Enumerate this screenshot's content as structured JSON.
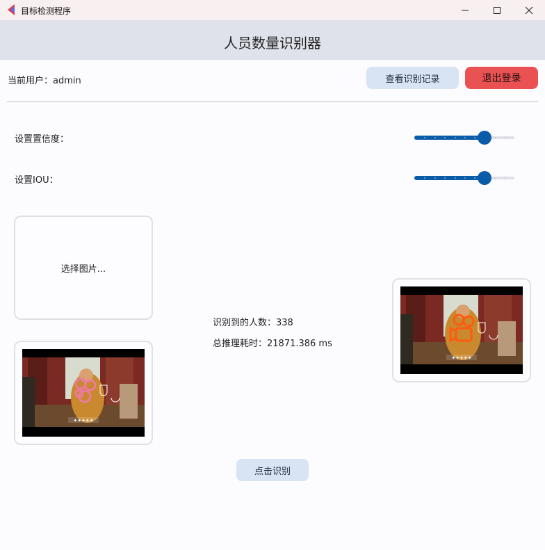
{
  "window": {
    "title": "目标检测程序",
    "controls": {
      "minimize_icon": "minimize-icon",
      "maximize_icon": "maximize-icon",
      "close_icon": "close-icon"
    }
  },
  "header": {
    "title": "人员数量识别器"
  },
  "user_bar": {
    "current_user": "当前用户：admin",
    "records_button": "查看识别记录",
    "logout_button": "退出登录"
  },
  "settings": {
    "confidence": {
      "label": "设置置信度：",
      "value": 0.7
    },
    "iou": {
      "label": "设置IOU：",
      "value": 0.7
    }
  },
  "input_panel": {
    "choose_label": "选择图片..."
  },
  "results": {
    "count_text": "识别到的人数：338",
    "time_text": "总推理耗时：21871.386 ms"
  },
  "detect_button": "点击识别",
  "colors": {
    "accent": "#0b5ca8",
    "logout": "#ea5152",
    "button_light": "#d8e3f3",
    "header_bg": "#dfe2ea",
    "titlebar_bg": "#f8eff0"
  }
}
